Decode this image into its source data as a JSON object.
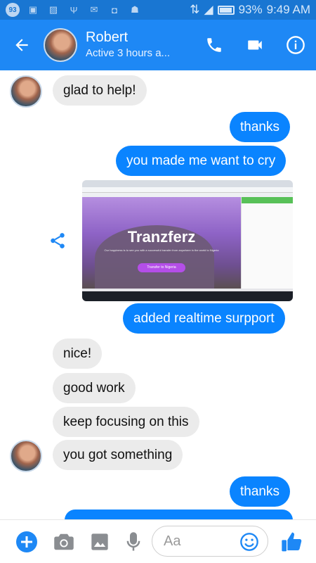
{
  "status_bar": {
    "badge": "93",
    "battery": "93%",
    "time": "9:49 AM"
  },
  "header": {
    "name": "Robert",
    "status": "Active 3 hours a..."
  },
  "messages": {
    "m1": "glad to help!",
    "m2": "thanks",
    "m3": "you made me want to cry",
    "m4": "added realtime surpport",
    "m5": "nice!",
    "m6": "good work",
    "m7": "keep focusing on this",
    "m8": "you got something",
    "m9": "thanks"
  },
  "shared_image": {
    "brand": "Tranzferz",
    "tagline": "Our happiness is to see you with a successful transfer from anywhere in the world to Nigeria",
    "cta": "Transfer to Nigeria"
  },
  "composer": {
    "placeholder": "Aa"
  },
  "colors": {
    "header": "#1e88f5",
    "outgoing": "#0a84ff",
    "incoming": "#ebebeb"
  }
}
